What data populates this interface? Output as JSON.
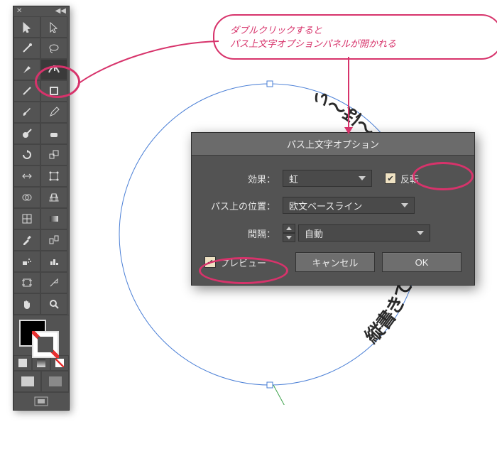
{
  "callout": {
    "line1": "ダブルクリックすると",
    "line2": "パス上文字オプションパネルが開かれる"
  },
  "tool_panel": {
    "header_close": "✕",
    "header_collapse": "◀◀"
  },
  "circle_text": "縦書きで反時計回りだぜ〜や〜ほ〜ぃ",
  "dialog": {
    "title": "パス上文字オプション",
    "effect_label": "効果：",
    "effect_value": "虹",
    "flip_label": "反転",
    "align_label": "パス上の位置：",
    "align_value": "欧文ベースライン",
    "spacing_label": "間隔：",
    "spacing_value": "自動",
    "preview_label": "プレビュー",
    "cancel": "キャンセル",
    "ok": "OK"
  }
}
